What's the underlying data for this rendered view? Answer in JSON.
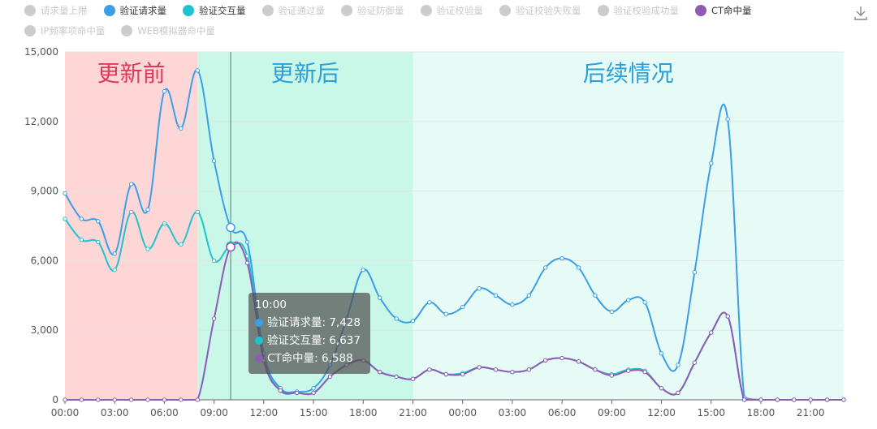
{
  "legend": {
    "rows": [
      [
        {
          "label": "请求量上限",
          "color": "#cccccc",
          "active": false
        },
        {
          "label": "验证请求量",
          "color": "#3a9ee8",
          "active": true
        },
        {
          "label": "验证交互量",
          "color": "#1fc3cf",
          "active": true
        },
        {
          "label": "验证通过量",
          "color": "#cccccc",
          "active": false
        },
        {
          "label": "验证防御量",
          "color": "#cccccc",
          "active": false
        },
        {
          "label": "验证校验量",
          "color": "#cccccc",
          "active": false
        },
        {
          "label": "验证校验失败量",
          "color": "#cccccc",
          "active": false
        },
        {
          "label": "验证校验成功量",
          "color": "#cccccc",
          "active": false
        },
        {
          "label": "CT命中量",
          "color": "#8e5bb5",
          "active": true
        }
      ],
      [
        {
          "label": "IP频率项命中量",
          "color": "#cccccc",
          "active": false
        },
        {
          "label": "WEB模拟器命中量",
          "color": "#cccccc",
          "active": false
        }
      ]
    ]
  },
  "download_icon": "download-icon",
  "tooltip": {
    "title": "10:00",
    "rows": [
      {
        "label": "验证请求量: 7,428",
        "color": "#3a9ee8"
      },
      {
        "label": "验证交互量: 6,637",
        "color": "#1fc3cf"
      },
      {
        "label": "CT命中量: 6,588",
        "color": "#8e5bb5"
      }
    ]
  },
  "chart_data": {
    "type": "area",
    "x": [
      "00:00",
      "01:00",
      "02:00",
      "03:00",
      "04:00",
      "05:00",
      "06:00",
      "07:00",
      "08:00",
      "09:00",
      "10:00",
      "11:00",
      "12:00",
      "13:00",
      "14:00",
      "15:00",
      "16:00",
      "17:00",
      "18:00",
      "19:00",
      "20:00",
      "21:00",
      "22:00",
      "23:00",
      "00:00",
      "01:00",
      "02:00",
      "03:00",
      "04:00",
      "05:00",
      "06:00",
      "07:00",
      "08:00",
      "09:00",
      "10:00",
      "11:00",
      "12:00",
      "13:00",
      "14:00",
      "15:00",
      "16:00",
      "17:00",
      "18:00",
      "19:00",
      "20:00",
      "21:00",
      "22:00",
      "23:00"
    ],
    "tick_labels": [
      "00:00",
      "03:00",
      "06:00",
      "09:00",
      "12:00",
      "15:00",
      "18:00",
      "21:00",
      "00:00",
      "03:00",
      "06:00",
      "09:00",
      "12:00",
      "15:00",
      "18:00",
      "21:00"
    ],
    "ylim": [
      0,
      15000
    ],
    "yticks": [
      "0",
      "3,000",
      "6,000",
      "9,000",
      "12,000",
      "15,000"
    ],
    "series": [
      {
        "name": "验证请求量",
        "color": "#3a9ee8",
        "values": [
          8900,
          7800,
          7700,
          6300,
          9300,
          8200,
          13300,
          11700,
          14200,
          10300,
          7428,
          6800,
          2000,
          500,
          350,
          500,
          1500,
          3500,
          5600,
          4400,
          3500,
          3400,
          4200,
          3700,
          4000,
          4800,
          4500,
          4100,
          4500,
          5700,
          6100,
          5700,
          4500,
          3800,
          4300,
          4200,
          2000,
          1500,
          5500,
          10200,
          12100,
          100,
          0,
          0,
          0,
          0,
          0,
          0
        ]
      },
      {
        "name": "验证交互量",
        "color": "#1fc3cf",
        "values": [
          7800,
          6900,
          6800,
          5600,
          8100,
          6500,
          7600,
          6700,
          8100,
          6000,
          6637,
          6200,
          1800,
          400,
          300,
          300,
          1000,
          1500,
          1700,
          1200,
          1000,
          900,
          1300,
          1100,
          1150,
          1400,
          1300,
          1200,
          1300,
          1700,
          1800,
          1650,
          1300,
          1100,
          1300,
          1250,
          500,
          300,
          1600,
          2900,
          3600,
          0,
          0,
          0,
          0,
          0,
          0,
          0
        ]
      },
      {
        "name": "CT命中量",
        "color": "#8e5bb5",
        "values": [
          0,
          0,
          0,
          0,
          0,
          0,
          0,
          0,
          0,
          3500,
          6588,
          5900,
          1700,
          400,
          300,
          300,
          1000,
          1500,
          1700,
          1200,
          1000,
          900,
          1300,
          1100,
          1100,
          1400,
          1300,
          1200,
          1300,
          1700,
          1800,
          1650,
          1300,
          1050,
          1250,
          1200,
          500,
          300,
          1600,
          2900,
          3600,
          0,
          0,
          0,
          0,
          0,
          0,
          0
        ]
      }
    ],
    "regions": [
      {
        "label": "更新前",
        "from": 0,
        "to": 8,
        "fill": "#ffd6d6",
        "text_color": "#e0395a"
      },
      {
        "label": "更新后",
        "from": 8,
        "to": 21,
        "fill": "#c9f7e8",
        "text_color": "#2a9fd8"
      },
      {
        "label": "后续情况",
        "from": 21,
        "to": 47,
        "fill": "#e6fbf5",
        "text_color": "#2a9fd8"
      }
    ],
    "crosshair_index": 10
  }
}
